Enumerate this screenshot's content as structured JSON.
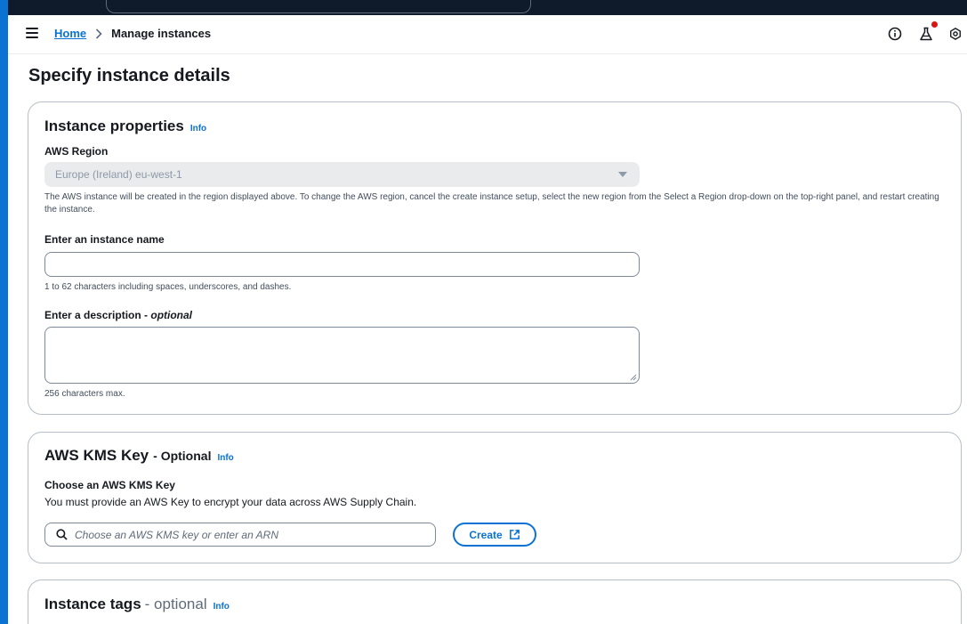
{
  "header": {
    "breadcrumb": [
      {
        "label": "Home"
      },
      {
        "label": "Manage instances"
      }
    ]
  },
  "page": {
    "title": "Specify instance details"
  },
  "instance_properties": {
    "heading": "Instance properties",
    "info": "Info",
    "region_label": "AWS Region",
    "region_value": "Europe (Ireland) eu-west-1",
    "region_help": "The AWS instance will be created in the region displayed above. To change the AWS region, cancel the create instance setup, select the new region from the Select a Region drop-down on the top-right panel, and restart creating the instance.",
    "name_label": "Enter an instance name",
    "name_value": "",
    "name_help": "1 to 62 characters including spaces, underscores, and dashes.",
    "description_label": "Enter a description - ",
    "description_optional": "optional",
    "description_value": "",
    "description_help": "256 characters max."
  },
  "kms": {
    "heading": "AWS KMS Key",
    "optional": "- Optional",
    "info": "Info",
    "choose_label": "Choose an AWS KMS Key",
    "help": "You must provide an AWS Key to encrypt your data across AWS Supply Chain.",
    "search_placeholder": "Choose an AWS KMS key or enter an ARN",
    "create_label": "Create"
  },
  "tags": {
    "heading": "Instance tags",
    "optional": "- optional",
    "info": "Info"
  },
  "colors": {
    "accent": "#0972d3",
    "notification_dot": "#d91515",
    "top_strip": "#0f1b2a"
  },
  "icons": [
    "menu-icon",
    "chevron-right-icon",
    "info-circle-icon",
    "flask-icon",
    "notification-dot",
    "settings-icon",
    "caret-down-icon",
    "search-icon",
    "external-link-icon",
    "resize-grip-icon"
  ]
}
